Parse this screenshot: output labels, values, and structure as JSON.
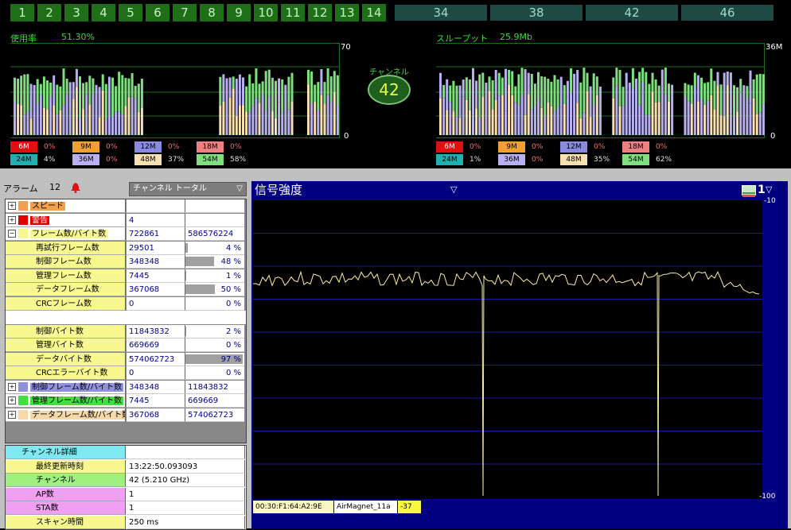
{
  "channels_24": [
    "1",
    "2",
    "3",
    "4",
    "5",
    "6",
    "7",
    "8",
    "9",
    "10",
    "11",
    "12",
    "13",
    "14"
  ],
  "channels_5": [
    "34",
    "38",
    "42",
    "46"
  ],
  "usage": {
    "label": "使用率",
    "value": "51.30%",
    "max": "70",
    "min": "0"
  },
  "throughput": {
    "label": "スループット",
    "value": "25.9Mb",
    "max": "36M",
    "min": "0"
  },
  "channel_badge": {
    "label": "チャンネル",
    "value": "42"
  },
  "rates_left": [
    {
      "rate": "6M",
      "pct": "0%",
      "color": "#e01010"
    },
    {
      "rate": "9M",
      "pct": "0%",
      "color": "#f0a030"
    },
    {
      "rate": "12M",
      "pct": "0%",
      "color": "#8a8ae0"
    },
    {
      "rate": "18M",
      "pct": "0%",
      "color": "#f08080"
    },
    {
      "rate": "24M",
      "pct": "4%",
      "color": "#20b0b0"
    },
    {
      "rate": "36M",
      "pct": "0%",
      "color": "#b8b0f0"
    },
    {
      "rate": "48M",
      "pct": "37%",
      "color": "#f8e0b0"
    },
    {
      "rate": "54M",
      "pct": "58%",
      "color": "#80e080"
    }
  ],
  "rates_right": [
    {
      "rate": "6M",
      "pct": "0%"
    },
    {
      "rate": "9M",
      "pct": "0%"
    },
    {
      "rate": "12M",
      "pct": "0%"
    },
    {
      "rate": "18M",
      "pct": "0%"
    },
    {
      "rate": "24M",
      "pct": "1%"
    },
    {
      "rate": "36M",
      "pct": "0%"
    },
    {
      "rate": "48M",
      "pct": "35%"
    },
    {
      "rate": "54M",
      "pct": "62%"
    }
  ],
  "alarm": {
    "label": "アラーム",
    "count": "12"
  },
  "channel_select": "チャンネル トータル",
  "stats": [
    {
      "label": "スピード",
      "v1": "",
      "v2": "",
      "type": "group",
      "bg": "#f0a050"
    },
    {
      "label": "警告",
      "v1": "4",
      "v2": "",
      "type": "group",
      "bg": "#e00000"
    },
    {
      "label": "フレーム数/バイト数",
      "v1": "722861",
      "v2": "586576224",
      "type": "group",
      "bg": "#f8f890"
    },
    {
      "label": "再試行フレーム数",
      "v1": "29501",
      "v2": "4 %",
      "type": "sub",
      "pct": 4
    },
    {
      "label": "制御フレーム数",
      "v1": "348348",
      "v2": "48 %",
      "type": "sub",
      "pct": 48
    },
    {
      "label": "管理フレーム数",
      "v1": "7445",
      "v2": "1 %",
      "type": "sub",
      "pct": 1
    },
    {
      "label": "データフレーム数",
      "v1": "367068",
      "v2": "50 %",
      "type": "sub",
      "pct": 50
    },
    {
      "label": "CRCフレーム数",
      "v1": "0",
      "v2": "0 %",
      "type": "sub",
      "pct": 0
    },
    {
      "label": "",
      "v1": "",
      "v2": "",
      "type": "blank"
    },
    {
      "label": "制御バイト数",
      "v1": "11843832",
      "v2": "2 %",
      "type": "sub",
      "pct": 2
    },
    {
      "label": "管理バイト数",
      "v1": "669669",
      "v2": "0 %",
      "type": "sub",
      "pct": 0
    },
    {
      "label": "データバイト数",
      "v1": "574062723",
      "v2": "97 %",
      "type": "sub",
      "pct": 97
    },
    {
      "label": "CRCエラーバイト数",
      "v1": "0",
      "v2": "0 %",
      "type": "sub",
      "pct": 0
    },
    {
      "label": "制御フレーム数/バイト数",
      "v1": "348348",
      "v2": "11843832",
      "type": "group",
      "bg": "#9090e0"
    },
    {
      "label": "管理フレーム数/バイト数",
      "v1": "7445",
      "v2": "669669",
      "type": "group",
      "bg": "#40e040"
    },
    {
      "label": "データフレーム数/バイト数",
      "v1": "367068",
      "v2": "574062723",
      "type": "group",
      "bg": "#f8d8a8"
    }
  ],
  "details": [
    {
      "label": "チャンネル詳細",
      "value": "",
      "bg": "#80e8f0"
    },
    {
      "label": "最終更新時刻",
      "value": "13:22:50.093093",
      "bg": "#f8f890"
    },
    {
      "label": "チャンネル",
      "value": "42 (5.210 GHz)",
      "bg": "#a0f080"
    },
    {
      "label": "AP数",
      "value": "1",
      "bg": "#f0a0f0"
    },
    {
      "label": "STA数",
      "value": "1",
      "bg": "#f0a0f0"
    },
    {
      "label": "スキャン時間",
      "value": "250 ms",
      "bg": "#f8f890"
    }
  ],
  "signal": {
    "title": "信号強度",
    "count": "1",
    "ymax": "-10",
    "ymin": "-100",
    "mac": "00:30:F1:64:A2:9E",
    "ssid": "AirMagnet_11a",
    "dbm": "-37"
  }
}
